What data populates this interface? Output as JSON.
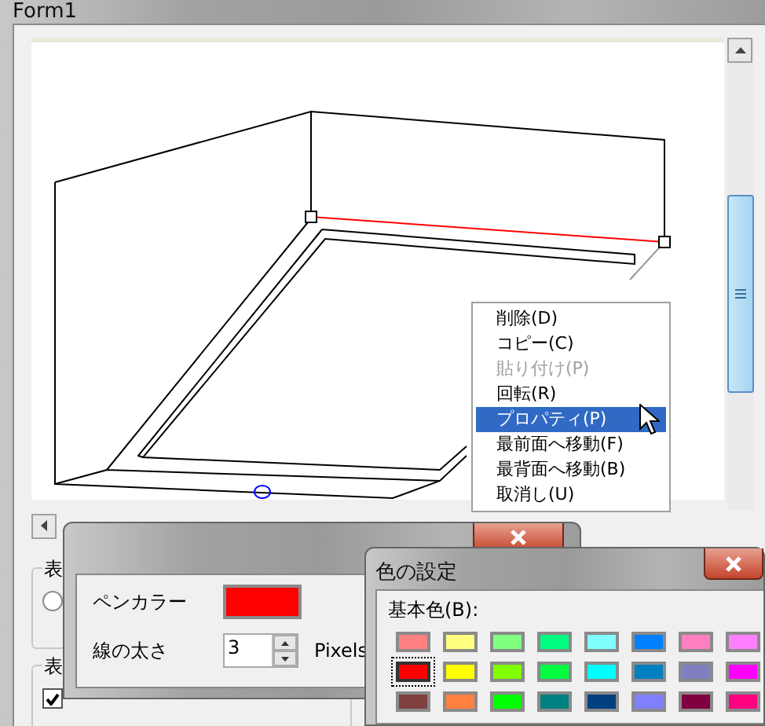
{
  "window": {
    "title": "Form1"
  },
  "group_boxes": [
    {
      "label": "表",
      "control": {
        "kind": "radio",
        "checked": false
      }
    },
    {
      "label": "表",
      "control": {
        "kind": "checkbox",
        "checked": true
      }
    }
  ],
  "context_menu": {
    "items": [
      {
        "label": "削除(D)",
        "disabled": false,
        "selected": false
      },
      {
        "label": "コピー(C)",
        "disabled": false,
        "selected": false
      },
      {
        "label": "貼り付け(P)",
        "disabled": true,
        "selected": false
      },
      {
        "label": "回転(R)",
        "disabled": false,
        "selected": false
      },
      {
        "label": "プロパティ(P)",
        "disabled": false,
        "selected": true
      },
      {
        "label": "最前面へ移動(F)",
        "disabled": false,
        "selected": false
      },
      {
        "label": "最背面へ移動(B)",
        "disabled": false,
        "selected": false
      },
      {
        "label": "取消し(U)",
        "disabled": false,
        "selected": false
      }
    ]
  },
  "pen_dialog": {
    "rows": [
      {
        "kind": "color",
        "label": "ペンカラー",
        "color": "#ff0000"
      },
      {
        "kind": "spinner",
        "label": "線の太さ",
        "value": "3",
        "unit": "Pixels"
      }
    ]
  },
  "color_dialog": {
    "title": "色の設定",
    "basic_colors_label": "基本色(B):",
    "swatches": [
      {
        "color": "#ff8080",
        "selected": false
      },
      {
        "color": "#ffff80",
        "selected": false
      },
      {
        "color": "#80ff80",
        "selected": false
      },
      {
        "color": "#00ff80",
        "selected": false
      },
      {
        "color": "#80ffff",
        "selected": false
      },
      {
        "color": "#0080ff",
        "selected": false
      },
      {
        "color": "#ff80c0",
        "selected": false
      },
      {
        "color": "#ff80ff",
        "selected": false
      },
      {
        "color": "#ff0000",
        "selected": true
      },
      {
        "color": "#ffff00",
        "selected": false
      },
      {
        "color": "#80ff00",
        "selected": false
      },
      {
        "color": "#00ff40",
        "selected": false
      },
      {
        "color": "#00ffff",
        "selected": false
      },
      {
        "color": "#0080c0",
        "selected": false
      },
      {
        "color": "#8080c0",
        "selected": false
      },
      {
        "color": "#ff00ff",
        "selected": false
      },
      {
        "color": "#804040",
        "selected": false
      },
      {
        "color": "#ff8040",
        "selected": false
      },
      {
        "color": "#00ff00",
        "selected": false
      },
      {
        "color": "#008080",
        "selected": false
      },
      {
        "color": "#004080",
        "selected": false
      },
      {
        "color": "#8080ff",
        "selected": false
      },
      {
        "color": "#800040",
        "selected": false
      },
      {
        "color": "#ff0080",
        "selected": false
      }
    ]
  }
}
